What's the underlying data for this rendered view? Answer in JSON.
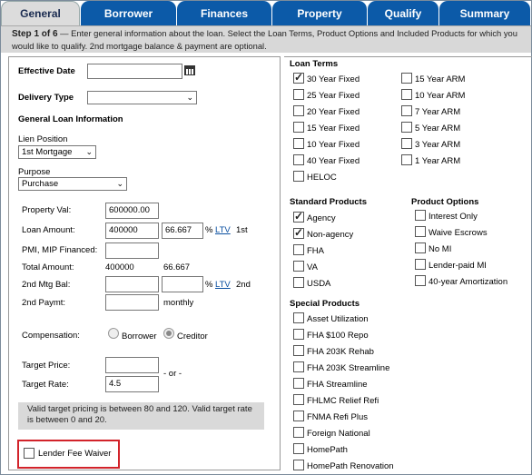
{
  "tabs": [
    "General",
    "Borrower",
    "Finances",
    "Property",
    "Qualify",
    "Summary"
  ],
  "step": {
    "title": "Step 1 of 6",
    "dash": " — ",
    "text": "Enter general information about the loan. Select the Loan Terms, Product Options and Included Products for which you would like to qualify. 2nd mortgage balance & payment are optional."
  },
  "left": {
    "effective_date_label": "Effective Date",
    "effective_date_value": "",
    "delivery_type_label": "Delivery Type",
    "delivery_type_value": "",
    "general_loan_info": "General Loan Information",
    "lien_position_label": "Lien Position",
    "lien_position_value": "1st Mortgage",
    "purpose_label": "Purpose",
    "purpose_value": "Purchase",
    "property_val_label": "Property Val:",
    "property_val_value": "600000.00",
    "loan_amount_label": "Loan Amount:",
    "loan_amount_value": "400000",
    "ltv_value": "66.667",
    "pct": "%",
    "ltv_link": "LTV",
    "first": "1st",
    "second": "2nd",
    "pmi_label": "PMI, MIP Financed:",
    "pmi_value": "",
    "total_amount_label": "Total Amount:",
    "total_amount_value": "400000",
    "total_ltv_value": "66.667",
    "second_mtg_bal_label": "2nd Mtg Bal:",
    "second_paymt_label": "2nd Paymt:",
    "monthly": "monthly",
    "compensation_label": "Compensation:",
    "borrower_option": "Borrower",
    "creditor_option": "Creditor",
    "target_price_label": "Target Price:",
    "target_price_value": "",
    "target_rate_label": "Target Rate:",
    "target_rate_value": "4.5",
    "or_text": "- or -",
    "note_text": "Valid target pricing is between 80 and 120. Valid target rate is between 0 and 20.",
    "lender_fee_waiver": "Lender Fee Waiver"
  },
  "loan_terms": {
    "title": "Loan Terms",
    "col1": [
      {
        "label": "30 Year Fixed",
        "checked": true
      },
      {
        "label": "25 Year Fixed",
        "checked": false
      },
      {
        "label": "20 Year Fixed",
        "checked": false
      },
      {
        "label": "15 Year Fixed",
        "checked": false
      },
      {
        "label": "10 Year Fixed",
        "checked": false
      },
      {
        "label": "40 Year Fixed",
        "checked": false
      },
      {
        "label": "HELOC",
        "checked": false
      }
    ],
    "col2": [
      {
        "label": "15 Year ARM",
        "checked": false
      },
      {
        "label": "10 Year ARM",
        "checked": false
      },
      {
        "label": "7 Year ARM",
        "checked": false
      },
      {
        "label": "5 Year ARM",
        "checked": false
      },
      {
        "label": "3 Year ARM",
        "checked": false
      },
      {
        "label": "1 Year ARM",
        "checked": false
      }
    ]
  },
  "standard_products": {
    "title": "Standard Products",
    "items": [
      {
        "label": "Agency",
        "checked": true
      },
      {
        "label": "Non-agency",
        "checked": true
      },
      {
        "label": "FHA",
        "checked": false
      },
      {
        "label": "VA",
        "checked": false
      },
      {
        "label": "USDA",
        "checked": false
      }
    ]
  },
  "product_options": {
    "title": "Product Options",
    "items": [
      {
        "label": "Interest Only",
        "checked": false
      },
      {
        "label": "Waive Escrows",
        "checked": false
      },
      {
        "label": "No MI",
        "checked": false
      },
      {
        "label": "Lender-paid MI",
        "checked": false
      },
      {
        "label": "40-year Amortization",
        "checked": false
      }
    ]
  },
  "special_products": {
    "title": "Special Products",
    "items": [
      {
        "label": "Asset Utilization",
        "checked": false
      },
      {
        "label": "FHA $100 Repo",
        "checked": false
      },
      {
        "label": "FHA 203K Rehab",
        "checked": false
      },
      {
        "label": "FHA 203K Streamline",
        "checked": false
      },
      {
        "label": "FHA Streamline",
        "checked": false
      },
      {
        "label": "FHLMC Relief Refi",
        "checked": false
      },
      {
        "label": "FNMA Refi Plus",
        "checked": false
      },
      {
        "label": "Foreign National",
        "checked": false
      },
      {
        "label": "HomePath",
        "checked": false
      },
      {
        "label": "HomePath Renovation",
        "checked": false
      }
    ]
  },
  "colors": {
    "tab_blue": "#0c5aa8",
    "active_tab": "#dcdcdc",
    "highlight_red": "#d2232a"
  }
}
